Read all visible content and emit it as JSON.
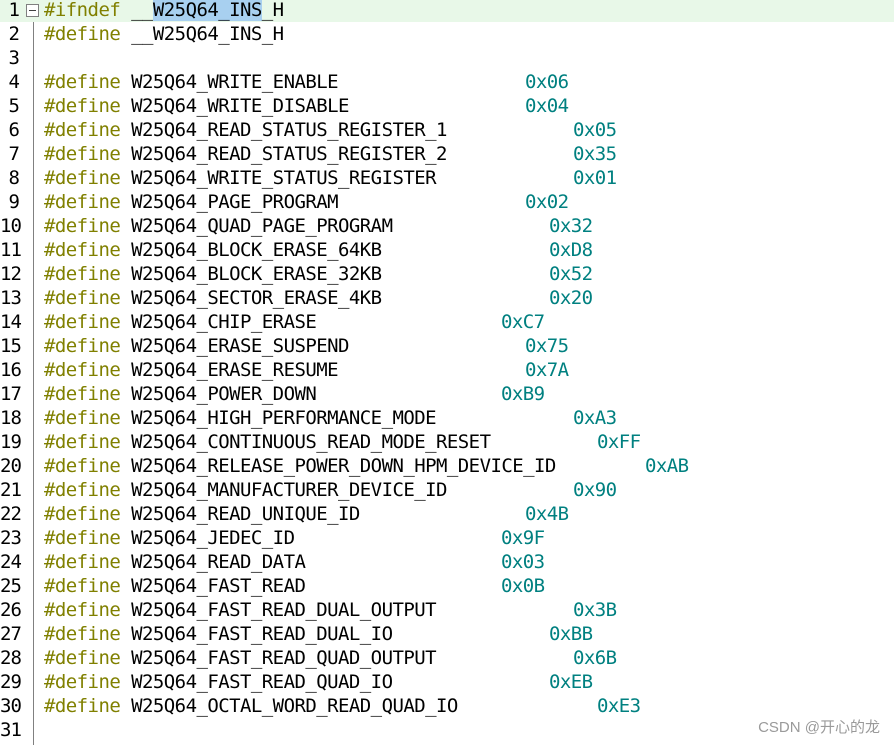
{
  "editor": {
    "lines": [
      {
        "num": "1",
        "kw": "#ifndef",
        "pre": " __",
        "sel": "W25Q64_INS",
        "post": "_H",
        "hex": ""
      },
      {
        "num": "2",
        "kw": "#define",
        "name": " __W25Q64_INS_H",
        "hex": ""
      },
      {
        "num": "3",
        "kw": "",
        "name": "",
        "hex": ""
      },
      {
        "num": "4",
        "kw": "#define",
        "name": " W25Q64_WRITE_ENABLE",
        "hex": "0x06"
      },
      {
        "num": "5",
        "kw": "#define",
        "name": " W25Q64_WRITE_DISABLE",
        "hex": "0x04"
      },
      {
        "num": "6",
        "kw": "#define",
        "name": " W25Q64_READ_STATUS_REGISTER_1",
        "hex": "0x05"
      },
      {
        "num": "7",
        "kw": "#define",
        "name": " W25Q64_READ_STATUS_REGISTER_2",
        "hex": "0x35"
      },
      {
        "num": "8",
        "kw": "#define",
        "name": " W25Q64_WRITE_STATUS_REGISTER",
        "hex": "0x01"
      },
      {
        "num": "9",
        "kw": "#define",
        "name": " W25Q64_PAGE_PROGRAM",
        "hex": "0x02"
      },
      {
        "num": "10",
        "kw": "#define",
        "name": " W25Q64_QUAD_PAGE_PROGRAM",
        "hex": "0x32"
      },
      {
        "num": "11",
        "kw": "#define",
        "name": " W25Q64_BLOCK_ERASE_64KB",
        "hex": "0xD8"
      },
      {
        "num": "12",
        "kw": "#define",
        "name": " W25Q64_BLOCK_ERASE_32KB",
        "hex": "0x52"
      },
      {
        "num": "13",
        "kw": "#define",
        "name": " W25Q64_SECTOR_ERASE_4KB",
        "hex": "0x20"
      },
      {
        "num": "14",
        "kw": "#define",
        "name": " W25Q64_CHIP_ERASE",
        "hex": "0xC7"
      },
      {
        "num": "15",
        "kw": "#define",
        "name": " W25Q64_ERASE_SUSPEND",
        "hex": "0x75"
      },
      {
        "num": "16",
        "kw": "#define",
        "name": " W25Q64_ERASE_RESUME",
        "hex": "0x7A"
      },
      {
        "num": "17",
        "kw": "#define",
        "name": " W25Q64_POWER_DOWN",
        "hex": "0xB9"
      },
      {
        "num": "18",
        "kw": "#define",
        "name": " W25Q64_HIGH_PERFORMANCE_MODE",
        "hex": "0xA3"
      },
      {
        "num": "19",
        "kw": "#define",
        "name": " W25Q64_CONTINUOUS_READ_MODE_RESET",
        "hex": "0xFF"
      },
      {
        "num": "20",
        "kw": "#define",
        "name": " W25Q64_RELEASE_POWER_DOWN_HPM_DEVICE_ID",
        "hex": "0xAB"
      },
      {
        "num": "21",
        "kw": "#define",
        "name": " W25Q64_MANUFACTURER_DEVICE_ID",
        "hex": "0x90"
      },
      {
        "num": "22",
        "kw": "#define",
        "name": " W25Q64_READ_UNIQUE_ID",
        "hex": "0x4B"
      },
      {
        "num": "23",
        "kw": "#define",
        "name": " W25Q64_JEDEC_ID",
        "hex": "0x9F"
      },
      {
        "num": "24",
        "kw": "#define",
        "name": " W25Q64_READ_DATA",
        "hex": "0x03"
      },
      {
        "num": "25",
        "kw": "#define",
        "name": " W25Q64_FAST_READ",
        "hex": "0x0B"
      },
      {
        "num": "26",
        "kw": "#define",
        "name": " W25Q64_FAST_READ_DUAL_OUTPUT",
        "hex": "0x3B"
      },
      {
        "num": "27",
        "kw": "#define",
        "name": " W25Q64_FAST_READ_DUAL_IO",
        "hex": "0xBB"
      },
      {
        "num": "28",
        "kw": "#define",
        "name": " W25Q64_FAST_READ_QUAD_OUTPUT",
        "hex": "0x6B"
      },
      {
        "num": "29",
        "kw": "#define",
        "name": " W25Q64_FAST_READ_QUAD_IO",
        "hex": "0xEB"
      },
      {
        "num": "30",
        "kw": "#define",
        "name": " W25Q64_OCTAL_WORD_READ_QUAD_IO",
        "hex": "0xE3"
      },
      {
        "num": "31",
        "kw": "",
        "name": "",
        "hex": ""
      }
    ]
  },
  "watermark": {
    "text": "CSDN @开心的龙"
  },
  "colors": {
    "keyword": "#808000",
    "hex_value": "#008080",
    "current_line": "#e8f8e8",
    "selection": "#a8d0f0"
  }
}
